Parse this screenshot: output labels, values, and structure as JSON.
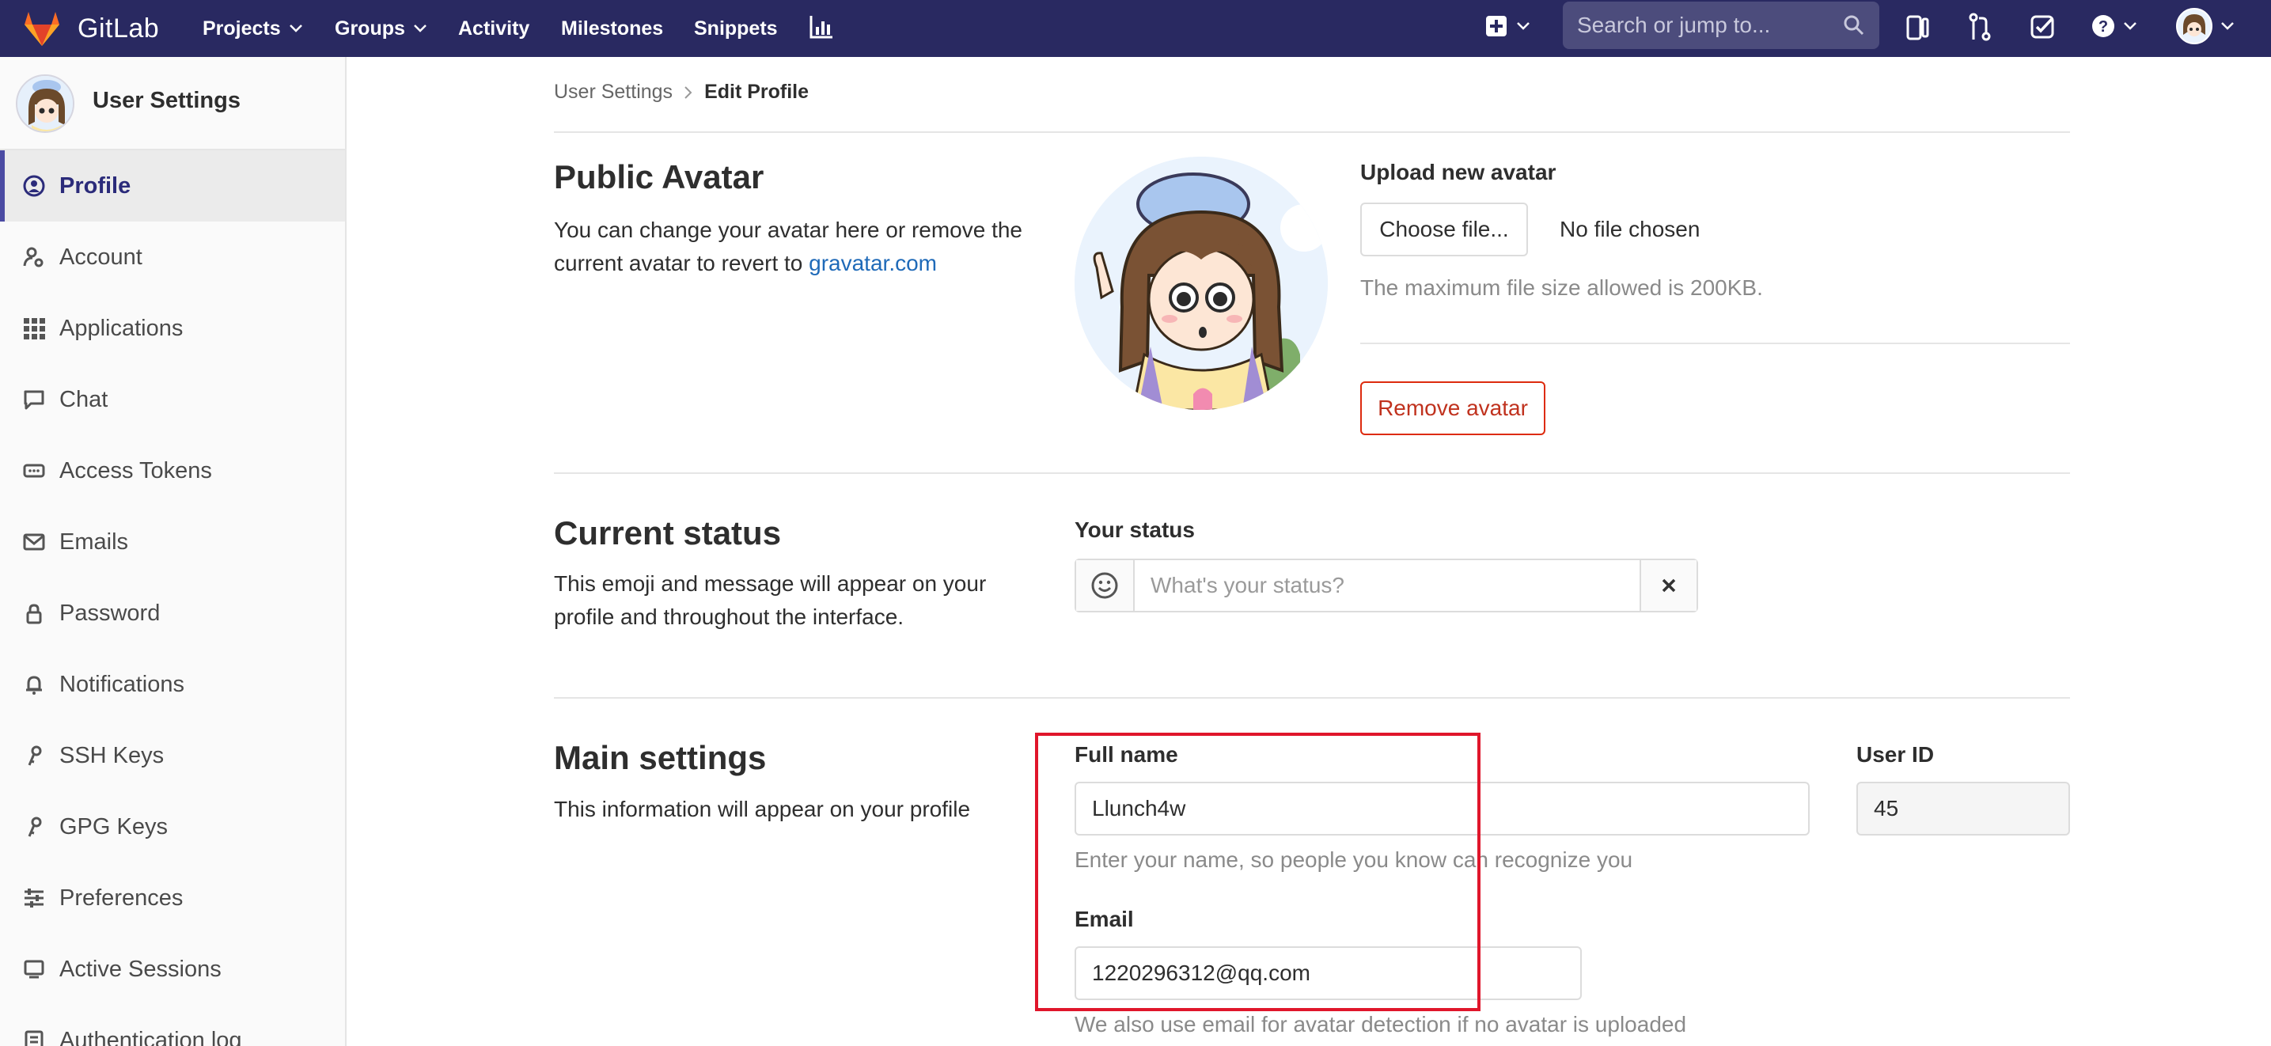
{
  "topbar": {
    "brand": "GitLab",
    "nav": [
      {
        "label": "Projects",
        "dropdown": true
      },
      {
        "label": "Groups",
        "dropdown": true
      },
      {
        "label": "Activity",
        "dropdown": false
      },
      {
        "label": "Milestones",
        "dropdown": false
      },
      {
        "label": "Snippets",
        "dropdown": false
      }
    ],
    "search_placeholder": "Search or jump to...",
    "icons": [
      "chart-icon",
      "plus-square-icon",
      "search-icon",
      "issues-icon",
      "merge-request-icon",
      "todo-check-icon",
      "help-icon",
      "user-avatar"
    ]
  },
  "sidebar": {
    "title": "User Settings",
    "items": [
      {
        "label": "Profile",
        "icon": "profile-icon",
        "active": true
      },
      {
        "label": "Account",
        "icon": "account-icon",
        "active": false
      },
      {
        "label": "Applications",
        "icon": "applications-icon",
        "active": false
      },
      {
        "label": "Chat",
        "icon": "chat-icon",
        "active": false
      },
      {
        "label": "Access Tokens",
        "icon": "token-icon",
        "active": false
      },
      {
        "label": "Emails",
        "icon": "envelope-icon",
        "active": false
      },
      {
        "label": "Password",
        "icon": "lock-icon",
        "active": false
      },
      {
        "label": "Notifications",
        "icon": "bell-icon",
        "active": false
      },
      {
        "label": "SSH Keys",
        "icon": "key-icon",
        "active": false
      },
      {
        "label": "GPG Keys",
        "icon": "key-icon",
        "active": false
      },
      {
        "label": "Preferences",
        "icon": "preferences-icon",
        "active": false
      },
      {
        "label": "Active Sessions",
        "icon": "monitor-icon",
        "active": false
      },
      {
        "label": "Authentication log",
        "icon": "log-icon",
        "active": false
      }
    ]
  },
  "breadcrumb": {
    "parent": "User Settings",
    "current": "Edit Profile"
  },
  "avatar_section": {
    "title": "Public Avatar",
    "desc_text": "You can change your avatar here or remove the current avatar to revert to ",
    "desc_link": "gravatar.com",
    "upload_label": "Upload new avatar",
    "choose_button": "Choose file...",
    "no_file": "No file chosen",
    "max_size_help": "The maximum file size allowed is 200KB.",
    "remove_button": "Remove avatar"
  },
  "status_section": {
    "title": "Current status",
    "desc": "This emoji and message will appear on your profile and throughout the interface.",
    "label": "Your status",
    "placeholder": "What's your status?"
  },
  "main_settings": {
    "title": "Main settings",
    "desc": "This information will appear on your profile",
    "full_name_label": "Full name",
    "full_name_value": "Llunch4w",
    "full_name_help": "Enter your name, so people you know can recognize you",
    "user_id_label": "User ID",
    "user_id_value": "45",
    "email_label": "Email",
    "email_value": "1220296312@qq.com",
    "email_help": "We also use email for avatar detection if no avatar is uploaded"
  },
  "colors": {
    "topbar_bg": "#292961",
    "active_accent": "#4b4ba3",
    "link": "#1f6ab8",
    "danger": "#dd2b0e",
    "highlight_box": "#e0162b"
  }
}
